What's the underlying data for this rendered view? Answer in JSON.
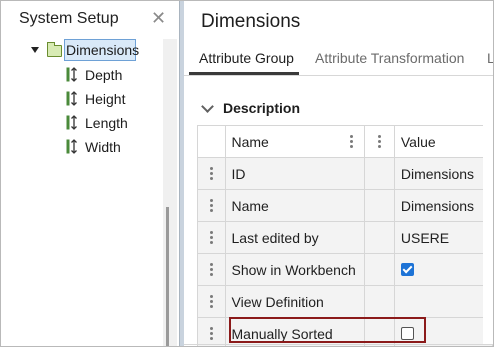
{
  "left_panel": {
    "title": "System Setup",
    "tree": {
      "root_label": "Dimensions",
      "children": [
        "Depth",
        "Height",
        "Length",
        "Width"
      ]
    }
  },
  "main": {
    "title": "Dimensions",
    "tabs": [
      "Attribute Group",
      "Attribute Transformation",
      "L"
    ],
    "active_tab": "Attribute Group",
    "section_title": "Description",
    "table": {
      "headers": {
        "name": "Name",
        "value": "Value"
      },
      "rows": [
        {
          "name": "ID",
          "value": "Dimensions"
        },
        {
          "name": "Name",
          "value": "Dimensions"
        },
        {
          "name": "Last edited by",
          "value": "USERE"
        },
        {
          "name": "Show in Workbench",
          "value": "",
          "checkbox": true
        },
        {
          "name": "View Definition",
          "value": ""
        },
        {
          "name": "Manually Sorted",
          "value": "",
          "checkbox": false
        }
      ]
    }
  },
  "colors": {
    "selection_fill": "#d9e9f8",
    "selection_border": "#6ea1d6",
    "checkbox_checked": "#1d73d6",
    "highlight_box": "#8b1a1a"
  }
}
